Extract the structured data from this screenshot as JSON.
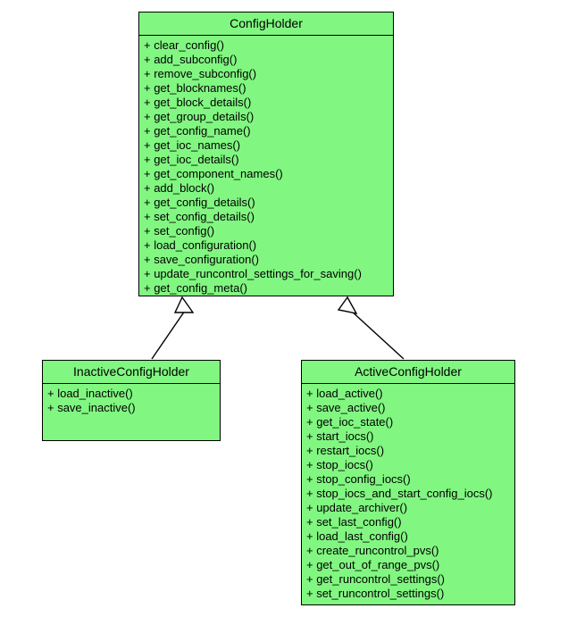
{
  "diagram": {
    "type": "uml-class-diagram",
    "background_color": "#ffffff",
    "class_fill_color": "#81F781",
    "border_color": "#000000",
    "text_color": "#000000",
    "relationship": "generalization",
    "classes": [
      {
        "id": "configholder",
        "name": "ConfigHolder",
        "attributes": [],
        "methods": [
          "+ clear_config()",
          "+ add_subconfig()",
          "+ remove_subconfig()",
          "+ get_blocknames()",
          "+ get_block_details()",
          "+ get_group_details()",
          "+ get_config_name()",
          "+ get_ioc_names()",
          "+ get_ioc_details()",
          "+ get_component_names()",
          "+ add_block()",
          "+ get_config_details()",
          "+ set_config_details()",
          "+ set_config()",
          "+ load_configuration()",
          "+ save_configuration()",
          "+ update_runcontrol_settings_for_saving()",
          "+ get_config_meta()"
        ]
      },
      {
        "id": "inactiveconfigholder",
        "name": "InactiveConfigHolder",
        "attributes": [],
        "methods": [
          "+ load_inactive()",
          "+ save_inactive()"
        ]
      },
      {
        "id": "activeconfigholder",
        "name": "ActiveConfigHolder",
        "attributes": [],
        "methods": [
          "+ load_active()",
          "+ save_active()",
          "+ get_ioc_state()",
          "+ start_iocs()",
          "+ restart_iocs()",
          "+ stop_iocs()",
          "+ stop_config_iocs()",
          "+ stop_iocs_and_start_config_iocs()",
          "+ update_archiver()",
          "+ set_last_config()",
          "+ load_last_config()",
          "+ create_runcontrol_pvs()",
          "+ get_out_of_range_pvs()",
          "+ get_runcontrol_settings()",
          "+ set_runcontrol_settings()"
        ]
      }
    ],
    "edges": [
      {
        "id": "edge-inactive-to-config",
        "from": "inactiveconfigholder",
        "to": "configholder",
        "kind": "inheritance"
      },
      {
        "id": "edge-active-to-config",
        "from": "activeconfigholder",
        "to": "configholder",
        "kind": "inheritance"
      }
    ]
  }
}
